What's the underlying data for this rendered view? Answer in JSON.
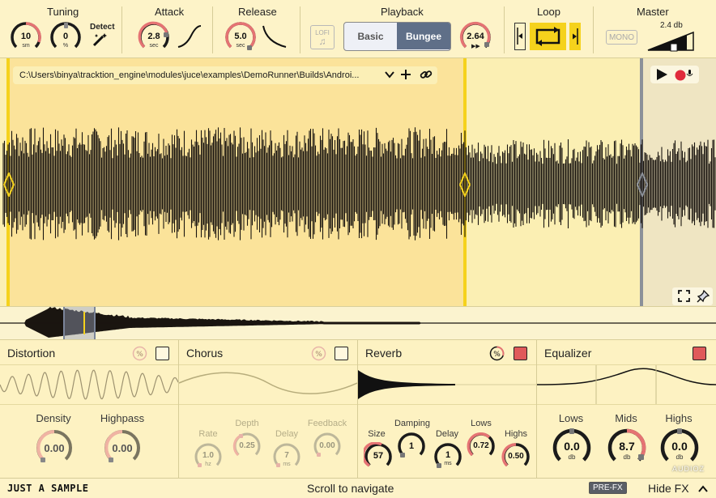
{
  "top": {
    "tuning": {
      "label": "Tuning",
      "semitones": {
        "value": "10",
        "unit": "sm"
      },
      "fine": {
        "value": "0",
        "unit": "%"
      },
      "detect_label": "Detect"
    },
    "attack": {
      "label": "Attack",
      "value": "2.8",
      "unit": "sec"
    },
    "release": {
      "label": "Release",
      "value": "5.0",
      "unit": "sec"
    },
    "playback": {
      "label": "Playback",
      "lofi_label": "LOFI",
      "basic_label": "Basic",
      "bungee_label": "Bungee",
      "speed_value": "2.64",
      "selected_mode": "Bungee"
    },
    "loop": {
      "label": "Loop"
    },
    "master": {
      "label": "Master",
      "mono_label": "MONO",
      "gain": "2.4 db",
      "level": 0.85
    }
  },
  "waveform": {
    "file_path": "C:\\Users\\binya\\tracktion_engine\\modules\\juce\\examples\\DemoRunner\\Builds\\Androi..."
  },
  "fx": {
    "distortion": {
      "title": "Distortion",
      "enabled": false,
      "params": [
        {
          "label": "Density",
          "value": "0.00"
        },
        {
          "label": "Highpass",
          "value": "0.00"
        }
      ]
    },
    "chorus": {
      "title": "Chorus",
      "enabled": false,
      "params": [
        {
          "label": "Rate",
          "value": "1.0",
          "unit": "hz"
        },
        {
          "label": "Depth",
          "value": "0.25"
        },
        {
          "label": "Delay",
          "value": "7",
          "unit": "ms"
        },
        {
          "label": "Feedback",
          "value": "0.00"
        }
      ]
    },
    "reverb": {
      "title": "Reverb",
      "enabled": true,
      "params": [
        {
          "label": "Size",
          "value": "57"
        },
        {
          "label": "Damping",
          "value": "1"
        },
        {
          "label": "Delay",
          "value": "1",
          "unit": "ms"
        },
        {
          "label": "Lows",
          "value": "0.72"
        },
        {
          "label": "Highs",
          "value": "0.50"
        }
      ]
    },
    "equalizer": {
      "title": "Equalizer",
      "enabled": true,
      "params": [
        {
          "label": "Lows",
          "value": "0.0",
          "unit": "db"
        },
        {
          "label": "Mids",
          "value": "8.7",
          "unit": "db"
        },
        {
          "label": "Highs",
          "value": "0.0",
          "unit": "db"
        }
      ]
    }
  },
  "bottom": {
    "logo_text": "JUST A SAMPLE",
    "hint": "Scroll to navigate",
    "prefx_label": "PRE-FX",
    "hide_fx_label": "Hide FX",
    "watermark": "AUDIOZ"
  },
  "colors": {
    "accent": "#f5d21c",
    "knob_arc": "#e57373",
    "enabled": "#e05a5a",
    "background": "#fdf3c8"
  }
}
